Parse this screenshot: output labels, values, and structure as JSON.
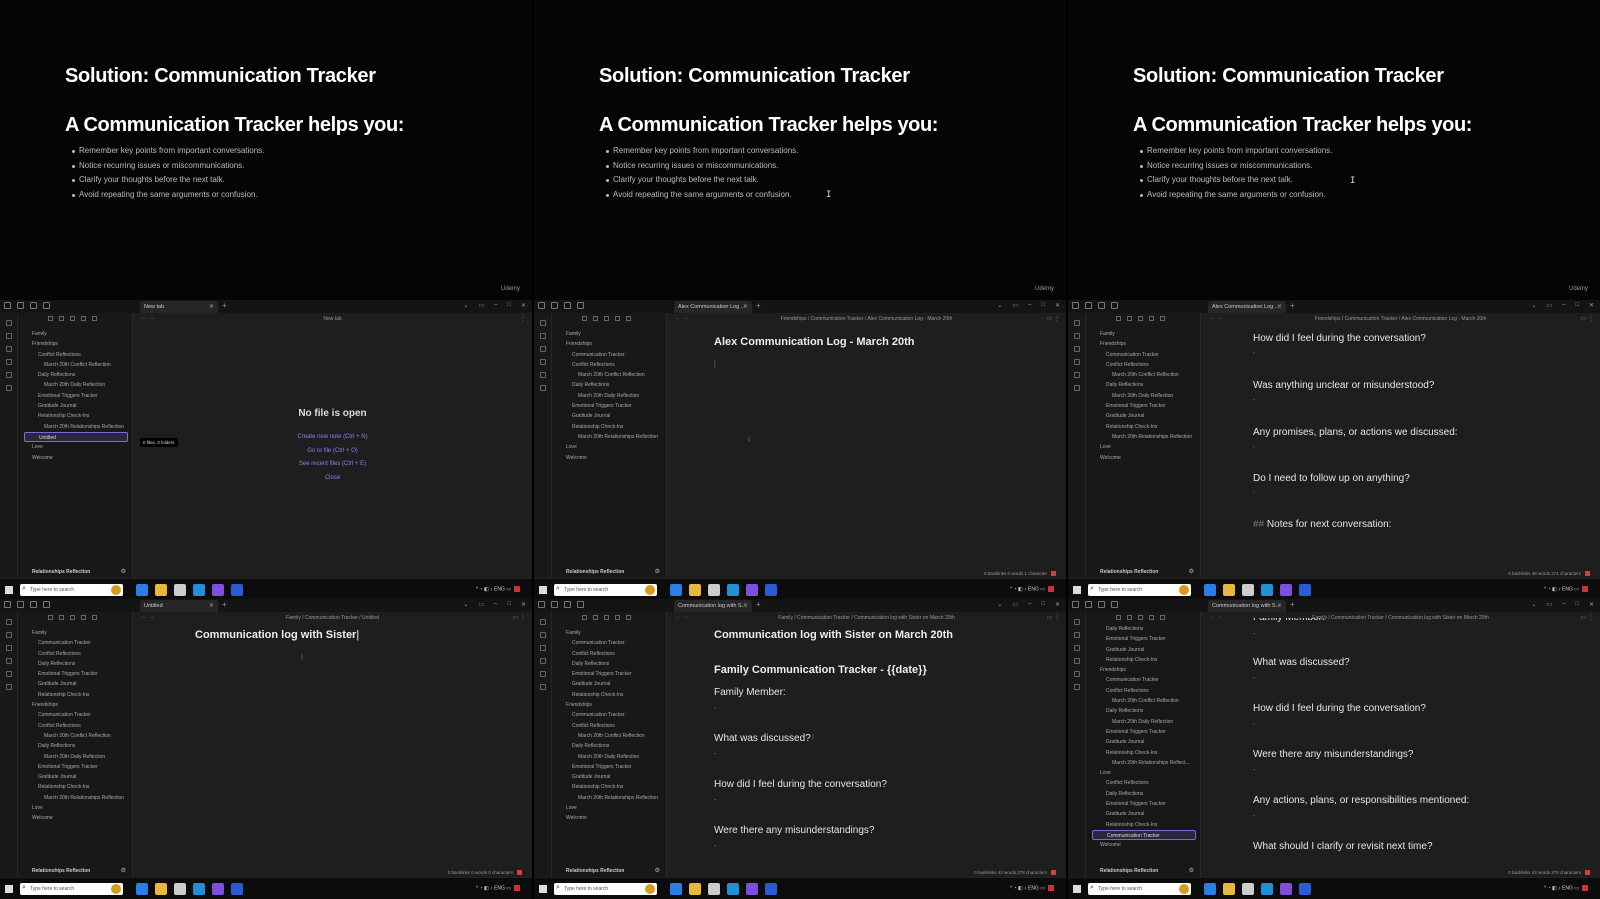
{
  "slides": [
    {
      "title": "Solution: Communication Tracker",
      "subtitle": "A Communication Tracker helps you:",
      "bullets": [
        "Remember key points from important conversations.",
        "Notice recurring issues or miscommunications.",
        "Clarify your thoughts before the next talk.",
        "Avoid repeating the same arguments or confusion."
      ],
      "brand": "Udemy",
      "cursor": ""
    },
    {
      "title": "Solution: Communication Tracker",
      "subtitle": "A Communication Tracker helps you:",
      "bullets": [
        "Remember key points from important conversations.",
        "Notice recurring issues or miscommunications.",
        "Clarify your thoughts before the next talk.",
        "Avoid repeating the same arguments or confusion."
      ],
      "brand": "Udemy",
      "cursor": "I"
    },
    {
      "title": "Solution: Communication Tracker",
      "subtitle": "A Communication Tracker helps you:",
      "bullets": [
        "Remember key points from important conversations.",
        "Notice recurring issues or miscommunications.",
        "Clarify your thoughts before the next talk.",
        "Avoid repeating the same arguments or confusion."
      ],
      "brand": "Udemy",
      "cursor": "I"
    }
  ],
  "taskbar": {
    "search_placeholder": "Type here to search",
    "tray": "ENG"
  },
  "vault_name": "Relationships Reflection",
  "win1": {
    "tab": "New tab",
    "crumb": "New tab",
    "tree": [
      "Family",
      "Friendships",
      "Conflict Reflections",
      "March 20th Conflict Reflection",
      "Daily Reflections",
      "March 20th Daily Reflection",
      "Emotional Triggers Tracker",
      "Gratitude Journal",
      "Relationship Check-Ins",
      "March 20th Relationships Reflection",
      "Untitled",
      "Love",
      "Welcome"
    ],
    "badge": "0 files, 0 folders",
    "nofile_title": "No file is open",
    "actions": [
      "Create new note (Ctrl + N)",
      "Go to file (Ctrl + O)",
      "See recent files (Ctrl + E)",
      "Close"
    ]
  },
  "win2": {
    "tab": "Alex Communication Log ...",
    "crumb": "Friendships / Communication Tracker / Alex Communication Log - March 20th",
    "tree": [
      "Family",
      "Friendships",
      "Communication Tracker",
      "Conflict Reflections",
      "March 20th Conflict Reflection",
      "Daily Reflections",
      "March 20th Daily Reflection",
      "Emotional Triggers Tracker",
      "Gratitude Journal",
      "Relationship Check-Ins",
      "March 20th Relationships Reflection",
      "Love",
      "Welcome"
    ],
    "heading": "Alex Communication Log - March 20th",
    "status": "0 backlinks   0 words  1 character"
  },
  "win3": {
    "tab": "Alex Communication Log ...",
    "crumb": "Friendships / Communication Tracker / Alex Communication Log - March 20th",
    "tree": [
      "Family",
      "Friendships",
      "Communication Tracker",
      "Conflict Reflections",
      "March 20th Conflict Reflection",
      "Daily Reflections",
      "March 20th Daily Reflection",
      "Emotional Triggers Tracker",
      "Gratitude Journal",
      "Relationship Check-Ins",
      "March 20th Relationships Reflection",
      "Love",
      "Welcome"
    ],
    "questions": [
      "How did I feel during the conversation?",
      "Was anything unclear or misunderstood?",
      "Any promises, plans, or actions we discussed:",
      "Do I need to follow up on anything?"
    ],
    "notes_prefix": "##",
    "notes": "Notes for next conversation:",
    "status": "0 backlinks   48 words  271 characters"
  },
  "win4": {
    "tab": "Untitled",
    "crumb": "Family / Communication Tracker / Untitled",
    "tree": [
      "Family",
      "Communication Tracker",
      "Conflict Reflections",
      "Daily Reflections",
      "Emotional Triggers Tracker",
      "Gratitude Journal",
      "Relationship Check-Ins",
      "Friendships",
      "Communication Tracker",
      "Conflict Reflections",
      "March 20th Conflict Reflection",
      "Daily Reflections",
      "March 20th Daily Reflection",
      "Emotional Triggers Tracker",
      "Gratitude Journal",
      "Relationship Check-Ins",
      "March 20th Relationships Reflection",
      "Love",
      "Welcome"
    ],
    "heading": "Communication log with Sister",
    "status": "0 backlinks   0 words  0 characters"
  },
  "win5": {
    "tab": "Communication log with S...",
    "crumb": "Family / Communication Tracker / Communication log with Sister on March 20th",
    "tree": [
      "Family",
      "Communication Tracker",
      "Conflict Reflections",
      "Daily Reflections",
      "Emotional Triggers Tracker",
      "Gratitude Journal",
      "Relationship Check-Ins",
      "Friendships",
      "Communication Tracker",
      "Conflict Reflections",
      "March 20th Conflict Reflection",
      "Daily Reflections",
      "March 20th Daily Reflection",
      "Emotional Triggers Tracker",
      "Gratitude Journal",
      "Relationship Check-Ins",
      "March 20th Relationships Reflection",
      "Love",
      "Welcome"
    ],
    "heading": "Communication log with Sister on March 20th",
    "template_title": "Family Communication Tracker - {{date}}",
    "member_label": "Family Member:",
    "questions": [
      "What was discussed?",
      "How did I feel during the conversation?",
      "Were there any misunderstandings?"
    ],
    "status": "0 backlinks   43 words  278 characters"
  },
  "win6": {
    "tab": "Communication log with S...",
    "crumb": "Family / Communication Tracker / Communication log with Sister on March 20th",
    "tree": [
      "Daily Reflections",
      "Emotional Triggers Tracker",
      "Gratitude Journal",
      "Relationship Check-Ins",
      "Friendships",
      "Communication Tracker",
      "Conflict Reflections",
      "March 20th Conflict Reflection",
      "Daily Reflections",
      "March 20th Daily Reflection",
      "Emotional Triggers Tracker",
      "Gratitude Journal",
      "Relationship Check-Ins",
      "March 20th Relationships Reflect...",
      "Love",
      "Conflict Reflections",
      "Daily Reflections",
      "Emotional Triggers Tracker",
      "Gratitude Journal",
      "Relationship Check-Ins",
      "Communication Tracker",
      "Welcome"
    ],
    "top_partial": "Family Member:",
    "questions": [
      "What was discussed?",
      "How did I feel during the conversation?",
      "Were there any misunderstandings?",
      "Any actions, plans, or responsibilities mentioned:",
      "What should I clarify or revisit next time?"
    ],
    "status": "0 backlinks   43 words  278 characters"
  }
}
